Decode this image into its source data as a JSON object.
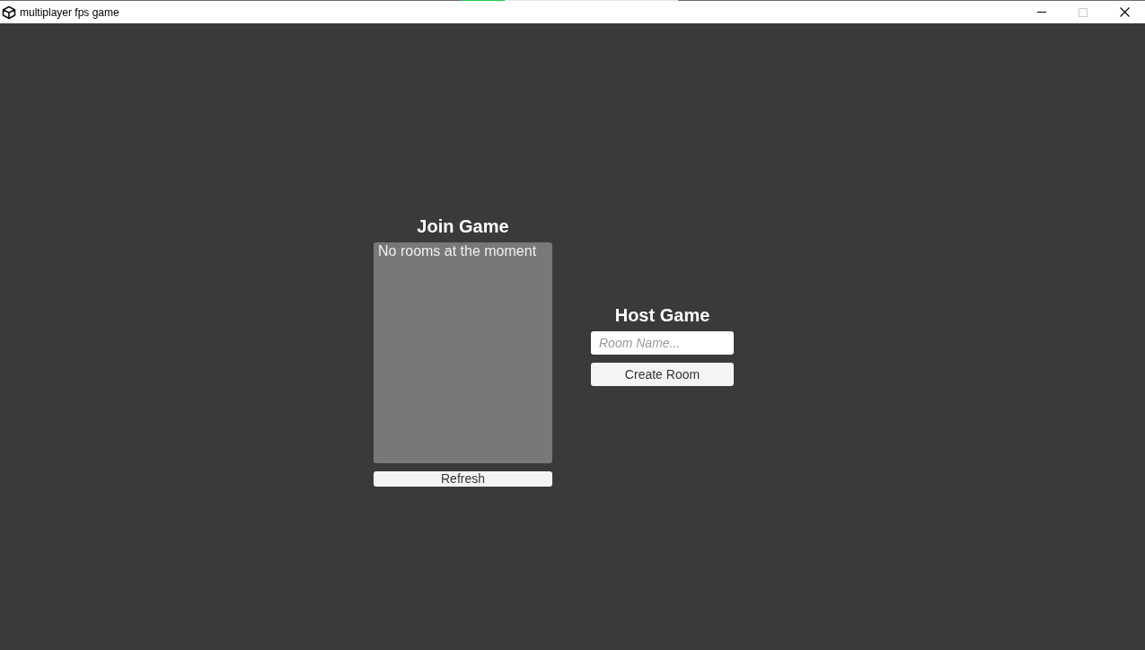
{
  "window": {
    "title": "multiplayer fps game",
    "controls": [
      {
        "kind": "minimize",
        "disabled": false
      },
      {
        "kind": "maximize",
        "disabled": true
      },
      {
        "kind": "close",
        "disabled": false
      }
    ]
  },
  "join_game": {
    "title": "Join Game",
    "room_list": {
      "message": "No rooms at the moment"
    },
    "refresh_button": "Refresh"
  },
  "host_game": {
    "title": "Host Game",
    "room_name_field": {
      "placeholder": "Room Name..."
    },
    "create_button": "Create Room"
  }
}
